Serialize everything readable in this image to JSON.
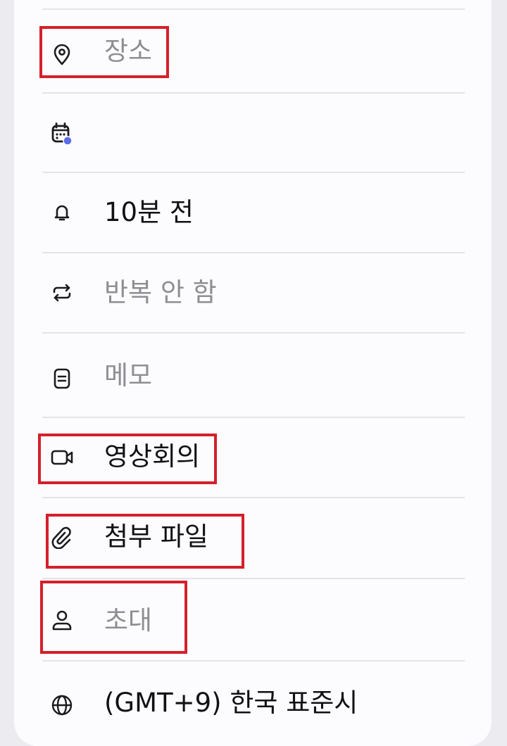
{
  "rows": [
    {
      "id": "location",
      "icon": "location-pin-icon",
      "label": "장소",
      "state": "placeholder"
    },
    {
      "id": "calendar",
      "icon": "calendar-icon",
      "label": "",
      "state": "value",
      "badge_color": "#5b6ee8"
    },
    {
      "id": "reminder",
      "icon": "bell-icon",
      "label": "10분 전",
      "state": "value"
    },
    {
      "id": "repeat",
      "icon": "repeat-icon",
      "label": "반복 안 함",
      "state": "placeholder"
    },
    {
      "id": "memo",
      "icon": "memo-icon",
      "label": "메모",
      "state": "placeholder"
    },
    {
      "id": "video",
      "icon": "video-camera-icon",
      "label": "영상회의",
      "state": "value"
    },
    {
      "id": "attachment",
      "icon": "paperclip-icon",
      "label": "첨부 파일",
      "state": "value"
    },
    {
      "id": "invite",
      "icon": "person-icon",
      "label": "초대",
      "state": "placeholder"
    },
    {
      "id": "timezone",
      "icon": "globe-icon",
      "label": "(GMT+9) 한국 표준시",
      "state": "value"
    }
  ],
  "highlight_color": "#d4202b"
}
